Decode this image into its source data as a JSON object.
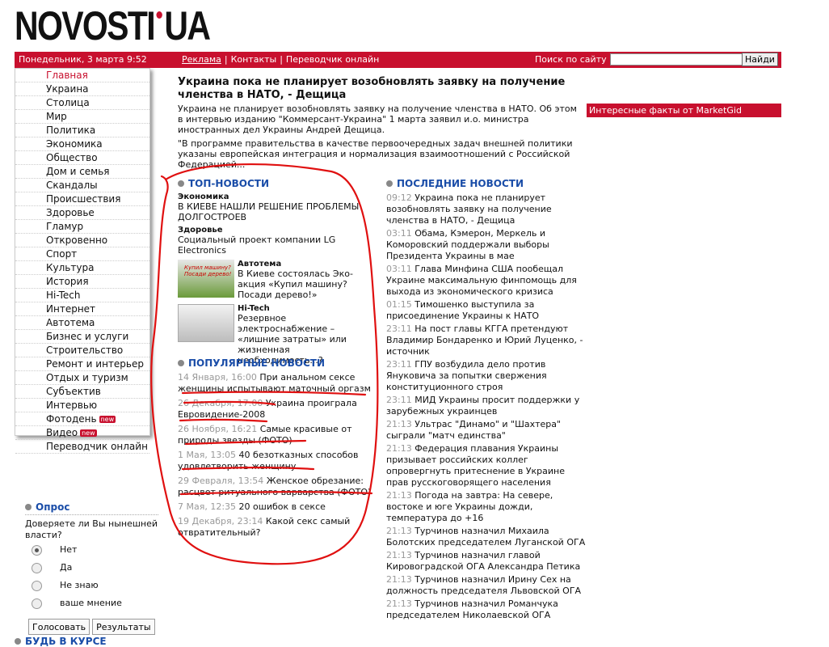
{
  "logo": {
    "left": "NOVOSTI",
    "right": "UA"
  },
  "topbar": {
    "date": "Понедельник, 3 марта 9:52",
    "links": [
      "Реклама",
      "Контакты",
      "Переводчик онлайн"
    ],
    "search_label": "Поиск по сайту",
    "search_value": "",
    "search_button": "Найди"
  },
  "sidebar": {
    "items": [
      {
        "label": "Главная"
      },
      {
        "label": "Украина"
      },
      {
        "label": "Столица"
      },
      {
        "label": "Мир"
      },
      {
        "label": "Политика"
      },
      {
        "label": "Экономика"
      },
      {
        "label": "Общество"
      },
      {
        "label": "Дом и семья"
      },
      {
        "label": "Скандалы"
      },
      {
        "label": "Происшествия"
      },
      {
        "label": "Здоровье"
      },
      {
        "label": "Гламур"
      },
      {
        "label": "Откровенно"
      },
      {
        "label": "Спорт"
      },
      {
        "label": "Культура"
      },
      {
        "label": "История"
      },
      {
        "label": "Hi-Tech"
      },
      {
        "label": "Интернет"
      },
      {
        "label": "Автотема"
      },
      {
        "label": "Бизнес и услуги"
      },
      {
        "label": "Строительство"
      },
      {
        "label": "Ремонт и интерьер"
      },
      {
        "label": "Отдых и туризм"
      },
      {
        "label": "Субъектив"
      },
      {
        "label": "Интервью"
      },
      {
        "label": "Фотодень",
        "badge": "new"
      },
      {
        "label": "Видео",
        "badge": "new"
      },
      {
        "label": "Переводчик онлайн"
      }
    ]
  },
  "headline": "Украина пока не планирует возобновлять заявку на получение членства в НАТО, - Дещица",
  "lead": {
    "p1": "Украина не планирует возобновлять заявку на получение членства в НАТО. Об этом в интервью изданию \"Коммерсант-Украина\"  1 марта заявил и.о. министра иностранных дел Украины Андрей Дещица.",
    "p2": "\"В программе правительства в качестве первоочередных задач внешней политики указаны европейская интеграция и нормализация взаимоотношений с Российской Федерацией..."
  },
  "market": "Интересные факты от MarketGid",
  "top_news": {
    "title": "ТОП-НОВОСТИ",
    "items": [
      {
        "category": "Экономика",
        "text": "В КИЕВЕ НАШЛИ РЕШЕНИЕ ПРОБЛЕМЫ ДОЛГОСТРОЕВ"
      },
      {
        "category": "Здоровье",
        "text": "Социальный проект компании LG Electronics"
      },
      {
        "category": "Автотема",
        "text": "В Киеве состоялась Эко-акция «Купил машину? Посади дерево!»",
        "thumb_text": "Купил машину? Посади дерево!"
      },
      {
        "category": "Hi-Tech",
        "text": "Резервное электроснабжение – «лишние затраты» или жизненная необходимость...?"
      }
    ]
  },
  "popular": {
    "title": "ПОПУЛЯРНЫЕ НОВОСТИ",
    "items": [
      {
        "time": "14 Января, 16:00",
        "text": "При анальном сексе женщины испытывают маточный оргазм"
      },
      {
        "time": "26 Декабря, 17:00",
        "text": "Украина проиграла Евровидение-2008"
      },
      {
        "time": "26 Ноября, 16:21",
        "text": "Самые красивые от природы звезды (ФОТО)"
      },
      {
        "time": "1 Мая, 13:05",
        "text": "40 безотказных способов удовлетворить женщину"
      },
      {
        "time": "29 Февраля, 13:54",
        "text": "Женское обрезание: расцвет ритуального варварства (ФОТО)"
      },
      {
        "time": "7 Мая, 12:35",
        "text": "20 ошибок в сексе"
      },
      {
        "time": "19 Декабря, 23:14",
        "text": "Какой секс самый отвратительный?"
      }
    ]
  },
  "latest": {
    "title": "ПОСЛЕДНИЕ НОВОСТИ",
    "items": [
      {
        "time": "09:12",
        "text": "Украина пока не планирует возобновлять заявку на получение членства в НАТО, - Дещица"
      },
      {
        "time": "03:11",
        "text": "Обама, Кэмерон, Меркель и Коморовский поддержали выборы Президента Украины в мае"
      },
      {
        "time": "03:11",
        "text": "Глава Минфина США пообещал Украине максимальную финпомощь для выхода из экономического кризиса"
      },
      {
        "time": "01:15",
        "text": "Тимошенко выступила за присоединение Украины к НАТО"
      },
      {
        "time": "23:11",
        "text": "На пост главы КГГА претендуют Владимир Бондаренко и Юрий Луценко, - источник"
      },
      {
        "time": "23:11",
        "text": "ГПУ возбудила дело против Януковича за попытки свержения конституционного строя"
      },
      {
        "time": "23:11",
        "text": "МИД Украины просит поддержки у зарубежных украинцев"
      },
      {
        "time": "21:13",
        "text": "Ультрас \"Динамо\" и \"Шахтера\" сыграли \"матч единства\""
      },
      {
        "time": "21:13",
        "text": "Федерация плавания Украины призывает российских коллег опровергнуть притеснение в Украине прав русскоговорящего населения"
      },
      {
        "time": "21:13",
        "text": "Погода на завтра: На севере, востоке и юге Украины дожди, температура до +16"
      },
      {
        "time": "21:13",
        "text": "Турчинов назначил Михаила Болотских председателем Луганской ОГА"
      },
      {
        "time": "21:13",
        "text": "Турчинов назначил главой Кировоградской ОГА Александра Петика"
      },
      {
        "time": "21:13",
        "text": "Турчинов назначил Ирину Сех на должность председателя Львовской ОГА"
      },
      {
        "time": "21:13",
        "text": "Турчинов назначил Романчука председателем Николаевской ОГА"
      }
    ]
  },
  "poll": {
    "title": "Опрос",
    "question": "Доверяете ли Вы нынешней власти?",
    "options": [
      "Нет",
      "Да",
      "Не знаю",
      "ваше мнение"
    ],
    "selected": 0,
    "vote_button": "Голосовать",
    "results_button": "Результаты"
  },
  "bottom_section": "БУДЬ В КУРСЕ",
  "colors": {
    "brand_red": "#c8102e",
    "section_blue": "#1a4da8",
    "ink_red": "#e01010"
  }
}
